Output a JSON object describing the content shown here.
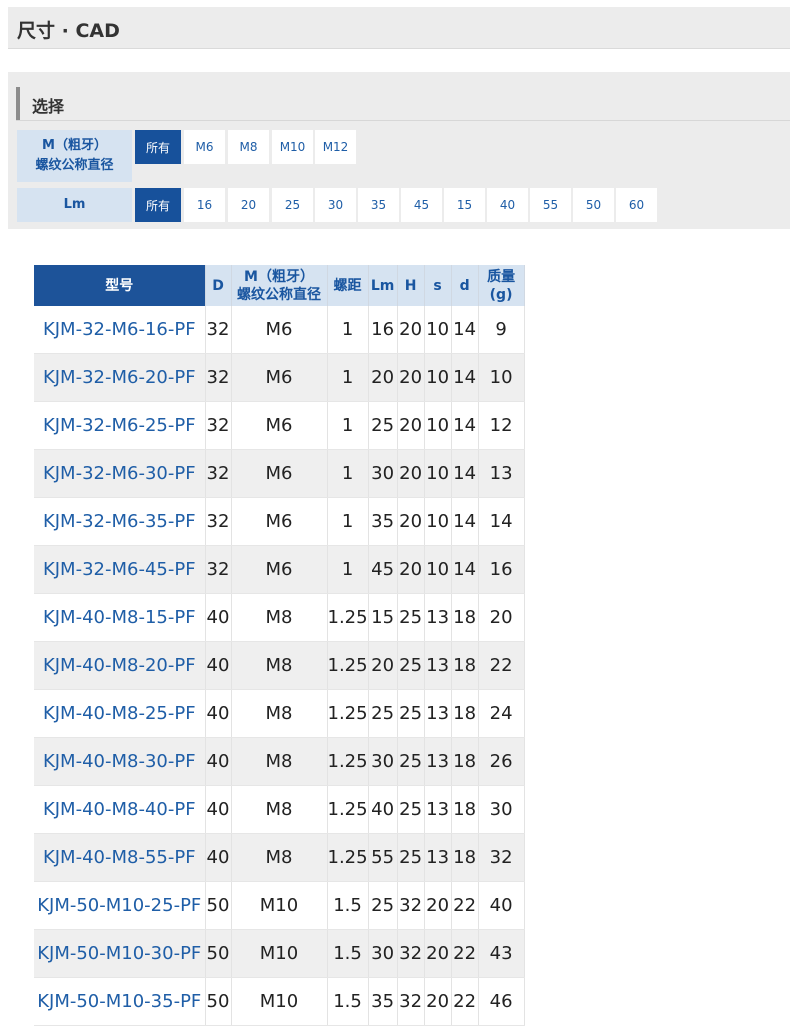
{
  "header": {
    "title": "尺寸 · CAD"
  },
  "select": {
    "heading": "选择"
  },
  "filters": [
    {
      "label_line1": "M（粗牙）",
      "label_line2": "螺纹公称直径",
      "options": [
        "所有",
        "M6",
        "M8",
        "M10",
        "M12"
      ],
      "selected": "所有"
    },
    {
      "label_line1": "Lm",
      "label_line2": "",
      "options": [
        "所有",
        "16",
        "20",
        "25",
        "30",
        "35",
        "45",
        "15",
        "40",
        "55",
        "50",
        "60"
      ],
      "selected": "所有"
    }
  ],
  "table": {
    "headers": {
      "model": "型号",
      "D": "D",
      "thread_line1": "M（粗牙）",
      "thread_line2": "螺纹公称直径",
      "pitch": "螺距",
      "Lm": "Lm",
      "H": "H",
      "s": "s",
      "d": "d",
      "mass_line1": "质量",
      "mass_line2": "(g)"
    },
    "rows": [
      [
        "KJM-32-M6-16-PF",
        "32",
        "M6",
        "1",
        "16",
        "20",
        "10",
        "14",
        "9"
      ],
      [
        "KJM-32-M6-20-PF",
        "32",
        "M6",
        "1",
        "20",
        "20",
        "10",
        "14",
        "10"
      ],
      [
        "KJM-32-M6-25-PF",
        "32",
        "M6",
        "1",
        "25",
        "20",
        "10",
        "14",
        "12"
      ],
      [
        "KJM-32-M6-30-PF",
        "32",
        "M6",
        "1",
        "30",
        "20",
        "10",
        "14",
        "13"
      ],
      [
        "KJM-32-M6-35-PF",
        "32",
        "M6",
        "1",
        "35",
        "20",
        "10",
        "14",
        "14"
      ],
      [
        "KJM-32-M6-45-PF",
        "32",
        "M6",
        "1",
        "45",
        "20",
        "10",
        "14",
        "16"
      ],
      [
        "KJM-40-M8-15-PF",
        "40",
        "M8",
        "1.25",
        "15",
        "25",
        "13",
        "18",
        "20"
      ],
      [
        "KJM-40-M8-20-PF",
        "40",
        "M8",
        "1.25",
        "20",
        "25",
        "13",
        "18",
        "22"
      ],
      [
        "KJM-40-M8-25-PF",
        "40",
        "M8",
        "1.25",
        "25",
        "25",
        "13",
        "18",
        "24"
      ],
      [
        "KJM-40-M8-30-PF",
        "40",
        "M8",
        "1.25",
        "30",
        "25",
        "13",
        "18",
        "26"
      ],
      [
        "KJM-40-M8-40-PF",
        "40",
        "M8",
        "1.25",
        "40",
        "25",
        "13",
        "18",
        "30"
      ],
      [
        "KJM-40-M8-55-PF",
        "40",
        "M8",
        "1.25",
        "55",
        "25",
        "13",
        "18",
        "32"
      ],
      [
        "KJM-50-M10-25-PF",
        "50",
        "M10",
        "1.5",
        "25",
        "32",
        "20",
        "22",
        "40"
      ],
      [
        "KJM-50-M10-30-PF",
        "50",
        "M10",
        "1.5",
        "30",
        "32",
        "20",
        "22",
        "43"
      ],
      [
        "KJM-50-M10-35-PF",
        "50",
        "M10",
        "1.5",
        "35",
        "32",
        "20",
        "22",
        "46"
      ]
    ]
  }
}
